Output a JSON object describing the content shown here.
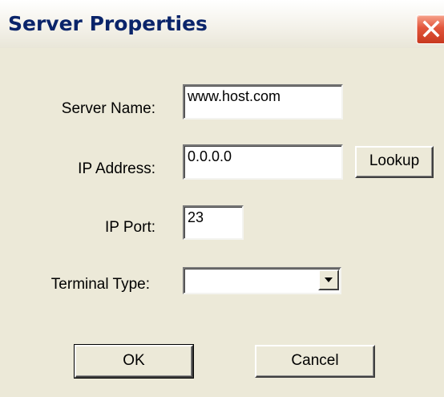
{
  "window": {
    "title": "Server Properties"
  },
  "form": {
    "server_name_label": "Server Name:",
    "server_name_value": "www.host.com",
    "ip_address_label": "IP Address:",
    "ip_address_value": "0.0.0.0",
    "lookup_label": "Lookup",
    "ip_port_label": "IP Port:",
    "ip_port_value": "23",
    "terminal_type_label": "Terminal Type:",
    "terminal_type_value": "",
    "ok_label": "OK",
    "cancel_label": "Cancel"
  },
  "icons": {
    "close": "close-icon",
    "dropdown": "chevron-down-icon"
  },
  "colors": {
    "background": "#ece9d8",
    "title_text": "#0a246a",
    "close_button": "#e2553b"
  }
}
